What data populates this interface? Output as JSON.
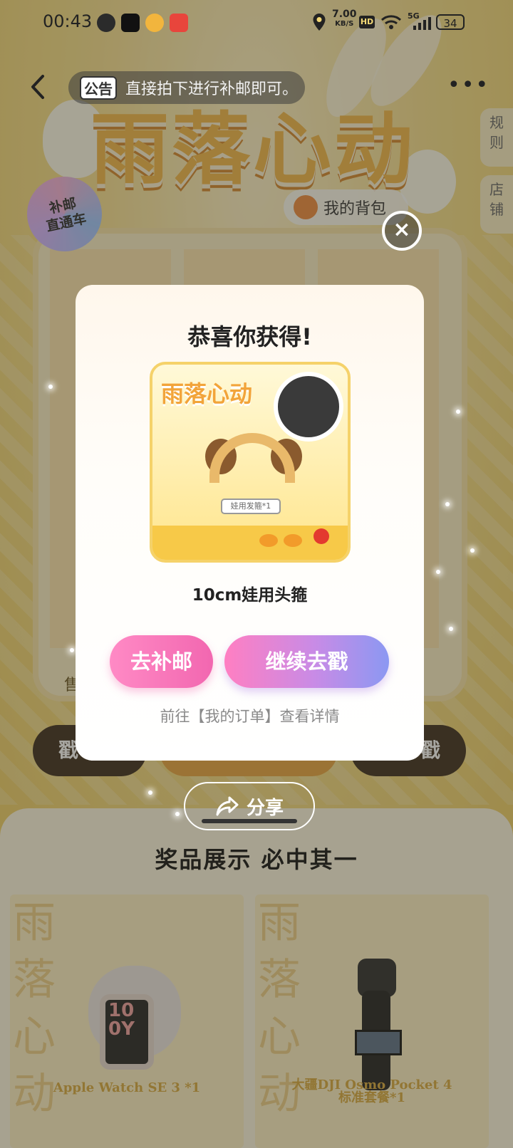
{
  "status_bar": {
    "time": "00:43",
    "network_speed": "7.00",
    "network_unit": "KB/S",
    "hd_label": "HD",
    "signal_label": "5G",
    "battery": "34"
  },
  "header": {
    "notice_badge": "公告",
    "notice_text": "直接拍下进行补邮即可。",
    "more": "•••"
  },
  "side_tabs": {
    "rules": "规则",
    "shop": "店铺"
  },
  "background": {
    "title_art": "雨落心动",
    "stamp_line1": "补邮",
    "stamp_line2": "直通车",
    "backpack_label": "我的背包",
    "sold_label": "售",
    "left_button": "戳",
    "right_button": "戳",
    "prize_heading": "奖品展示 必中其一",
    "prizes": [
      {
        "name": "Apple Watch SE 3 *1",
        "watermark": "雨落心动"
      },
      {
        "name_line1": "大疆DJI Osmo Pocket 4",
        "name_line2": "标准套餐*1",
        "watermark": "雨落心动"
      }
    ],
    "watch_face": "10\n0Y"
  },
  "modal": {
    "title": "恭喜你获得!",
    "prize_logo": "雨落心动",
    "prize_tag": "娃用发箍*1",
    "prize_name": "10cm娃用头箍",
    "ship_button": "去补邮",
    "continue_button": "继续去戳",
    "order_hint": "前往【我的订单】查看详情",
    "close": "×"
  },
  "share": {
    "label": "分享"
  }
}
